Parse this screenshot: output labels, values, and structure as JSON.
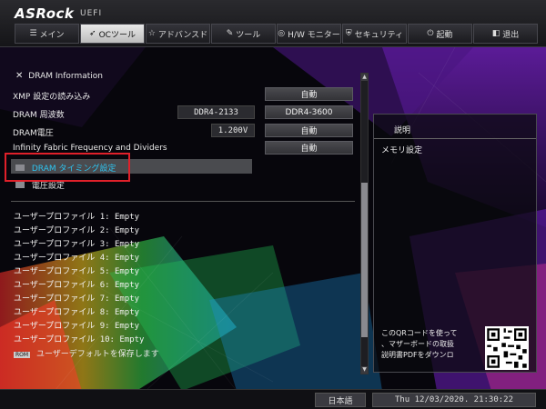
{
  "brand": {
    "logo": "ASRock",
    "product": "UEFI"
  },
  "tabs": [
    {
      "label": "メイン",
      "icon": "list-icon"
    },
    {
      "label": "OCツール",
      "icon": "rocket-icon",
      "active": true
    },
    {
      "label": "アドバンスド",
      "icon": "star-icon"
    },
    {
      "label": "ツール",
      "icon": "wrench-icon"
    },
    {
      "label": "H/W モニター",
      "icon": "monitor-icon"
    },
    {
      "label": "セキュリティ",
      "icon": "shield-icon"
    },
    {
      "label": "起動",
      "icon": "power-icon"
    },
    {
      "label": "退出",
      "icon": "exit-icon"
    }
  ],
  "settings": {
    "dram_info": "DRAM Information",
    "xmp_label": "XMP 設定の読み込み",
    "xmp_value": "自動",
    "freq_label": "DRAM 周波数",
    "freq_current": "DDR4-2133",
    "freq_value": "DDR4-3600",
    "volt_label": "DRAM電圧",
    "volt_current": "1.200V",
    "volt_value": "自動",
    "fabric_label": "Infinity Fabric Frequency and Dividers",
    "fabric_value": "自動",
    "timing_label": "DRAM タイミング設定",
    "voltage_settings_label": "電圧設定"
  },
  "profiles": [
    "ユーザープロファイル 1: Empty",
    "ユーザープロファイル 2: Empty",
    "ユーザープロファイル 3: Empty",
    "ユーザープロファイル 4: Empty",
    "ユーザープロファイル 5: Empty",
    "ユーザープロファイル 6: Empty",
    "ユーザープロファイル 7: Empty",
    "ユーザープロファイル 8: Empty",
    "ユーザープロファイル 9: Empty",
    "ユーザープロファイル 10: Empty"
  ],
  "save_default": {
    "badge": "ROM",
    "label": "ユーザーデフォルトを保存します"
  },
  "description": {
    "title": "説明",
    "text": "メモリ設定",
    "qr_line1": "このQRコードを使って",
    "qr_line2": "、マザーボードの取扱",
    "qr_line3": "説明書PDFをダウンロ"
  },
  "footer": {
    "language": "日本語",
    "clock": "Thu 12/03/2020. 21:30:22"
  },
  "colors": {
    "highlight_box": "#e0202a",
    "timing_text": "#2ec4f0",
    "selected_row": "#4a4b4f"
  }
}
